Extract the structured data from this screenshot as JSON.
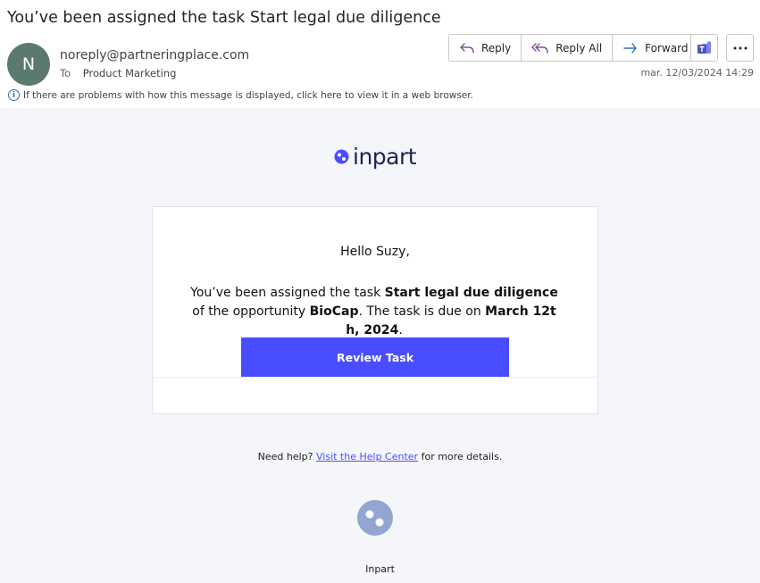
{
  "email": {
    "subject": "You’ve been assigned the task Start legal due diligence",
    "avatar_initial": "N",
    "sender": "noreply@partneringplace.com",
    "to_label": "To",
    "recipient": "Product Marketing",
    "date": "mar. 12/03/2024 14:29",
    "info_text": "If there are problems with how this message is displayed, click here to view it in a web browser."
  },
  "actions": {
    "reply": "Reply",
    "reply_all": "Reply All",
    "forward": "Forward",
    "teams_icon": "teams-icon",
    "more_icon": "more-icon"
  },
  "content": {
    "logo_text": "inpart",
    "greeting": "Hello Suzy,",
    "msg_part1": "You’ve been assigned the task ",
    "task_name": "Start legal due diligence",
    "msg_part2": " of the opportunity ",
    "opportunity": "BioCap",
    "msg_part3": ". The task is due on ",
    "due_date": "March 12th, 2024",
    "msg_part4": ".",
    "button_label": "Review Task",
    "help_prefix": "Need help? ",
    "help_link": "Visit the Help Center",
    "help_suffix": " for more details.",
    "footer_name": "Inpart"
  },
  "colors": {
    "accent": "#4a4dff",
    "avatar": "#5b7a6f",
    "body_bg": "#f5f6f9",
    "logo_dark": "#1e2351"
  }
}
